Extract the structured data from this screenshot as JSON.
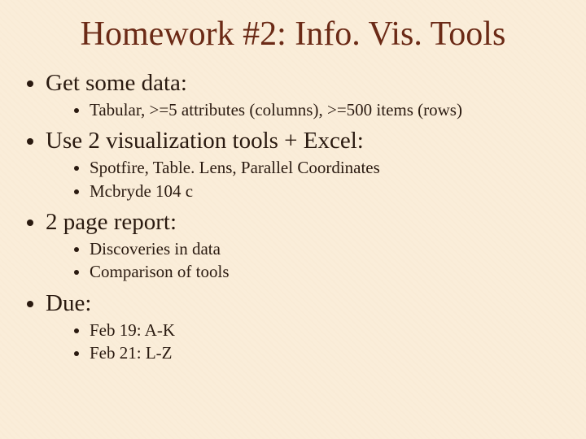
{
  "title": "Homework #2:  Info. Vis. Tools",
  "sections": [
    {
      "label": "Get some data:",
      "items": [
        "Tabular, >=5 attributes (columns), >=500 items (rows)"
      ]
    },
    {
      "label": "Use 2 visualization tools + Excel:",
      "items": [
        "Spotfire, Table. Lens, Parallel Coordinates",
        "Mcbryde 104 c"
      ]
    },
    {
      "label": "2 page report:",
      "items": [
        "Discoveries in data",
        "Comparison of tools"
      ]
    },
    {
      "label": "Due:",
      "items": [
        "Feb 19:  A-K",
        "Feb 21:  L-Z"
      ]
    }
  ]
}
